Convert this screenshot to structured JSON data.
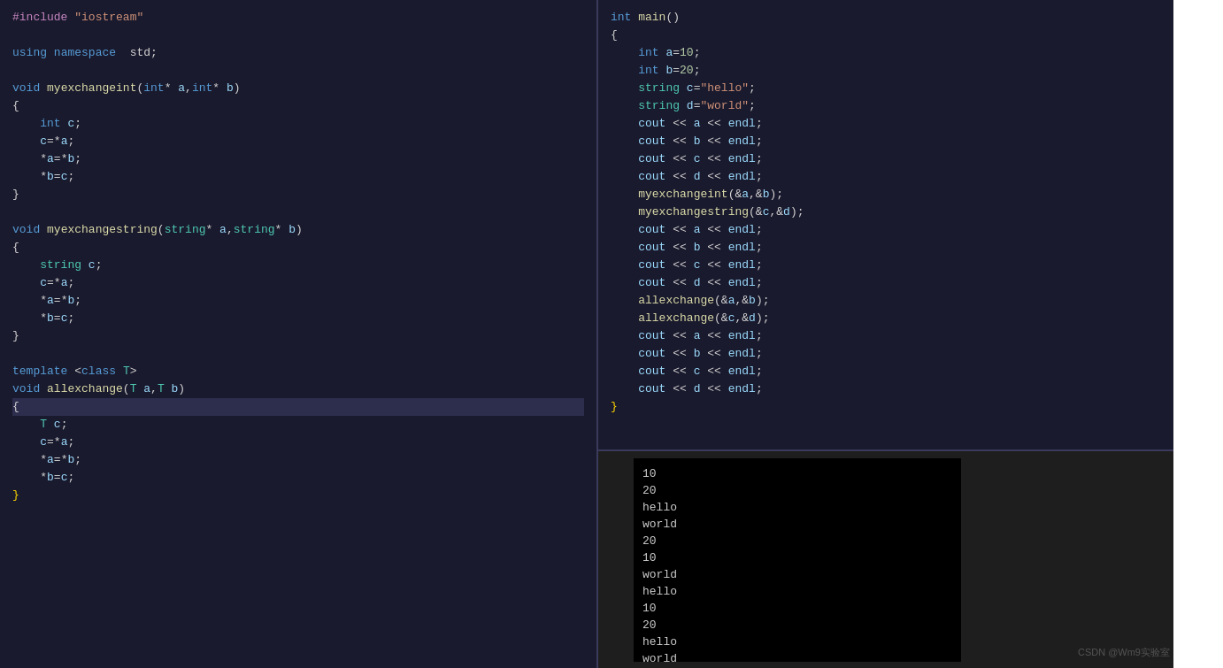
{
  "left_code": {
    "lines": [
      {
        "content": "#include \"iostream\"",
        "type": "include"
      },
      {
        "content": "",
        "type": "blank"
      },
      {
        "content": "using namespace std;",
        "type": "using"
      },
      {
        "content": "",
        "type": "blank"
      },
      {
        "content": "void myexchangeint(int* a,int* b)",
        "type": "fn_decl"
      },
      {
        "content": "{",
        "type": "brace"
      },
      {
        "content": "    int c;",
        "type": "code"
      },
      {
        "content": "    c=*a;",
        "type": "code"
      },
      {
        "content": "    *a=*b;",
        "type": "code"
      },
      {
        "content": "    *b=c;",
        "type": "code"
      },
      {
        "content": "}",
        "type": "brace"
      },
      {
        "content": "",
        "type": "blank"
      },
      {
        "content": "void myexchangestring(string* a,string* b)",
        "type": "fn_decl"
      },
      {
        "content": "{",
        "type": "brace"
      },
      {
        "content": "    string c;",
        "type": "code"
      },
      {
        "content": "    c=*a;",
        "type": "code"
      },
      {
        "content": "    *a=*b;",
        "type": "code"
      },
      {
        "content": "    *b=c;",
        "type": "code"
      },
      {
        "content": "}",
        "type": "brace"
      },
      {
        "content": "",
        "type": "blank"
      },
      {
        "content": "template <class T>",
        "type": "template"
      },
      {
        "content": "void allexchange(T a,T b)",
        "type": "fn_decl2"
      },
      {
        "content": "{",
        "type": "brace_hl"
      },
      {
        "content": "    T c;",
        "type": "code"
      },
      {
        "content": "    c=*a;",
        "type": "code"
      },
      {
        "content": "    *a=*b;",
        "type": "code"
      },
      {
        "content": "    *b=c;",
        "type": "code"
      },
      {
        "content": "}",
        "type": "brace"
      }
    ]
  },
  "right_code": {
    "lines": [
      {
        "content": "int main()",
        "type": "fn_main"
      },
      {
        "content": "{",
        "type": "brace"
      },
      {
        "content": "    int a=10;",
        "type": "code"
      },
      {
        "content": "    int b=20;",
        "type": "code"
      },
      {
        "content": "    string c=\"hello\";",
        "type": "code"
      },
      {
        "content": "    string d=\"world\";",
        "type": "code"
      },
      {
        "content": "    cout << a << endl;",
        "type": "code"
      },
      {
        "content": "    cout << b << endl;",
        "type": "code"
      },
      {
        "content": "    cout << c << endl;",
        "type": "code"
      },
      {
        "content": "    cout << d << endl;",
        "type": "code"
      },
      {
        "content": "    myexchangeint(&a,&b);",
        "type": "code"
      },
      {
        "content": "    myexchangestring(&c,&d);",
        "type": "code"
      },
      {
        "content": "    cout << a << endl;",
        "type": "code"
      },
      {
        "content": "    cout << b << endl;",
        "type": "code"
      },
      {
        "content": "    cout << c << endl;",
        "type": "code"
      },
      {
        "content": "    cout << d << endl;",
        "type": "code"
      },
      {
        "content": "    allexchange(&a,&b);",
        "type": "code"
      },
      {
        "content": "    allexchange(&c,&d);",
        "type": "code"
      },
      {
        "content": "    cout << a << endl;",
        "type": "code"
      },
      {
        "content": "    cout << b << endl;",
        "type": "code"
      },
      {
        "content": "    cout << c << endl;",
        "type": "code"
      },
      {
        "content": "    cout << d << endl;",
        "type": "code"
      },
      {
        "content": "}",
        "type": "brace_end"
      }
    ]
  },
  "console_output": {
    "lines": [
      "10",
      "20",
      "hello",
      "world",
      "20",
      "10",
      "world",
      "hello",
      "10",
      "20",
      "hello",
      "world"
    ]
  },
  "watermark": "CSDN @Wm9实验室"
}
